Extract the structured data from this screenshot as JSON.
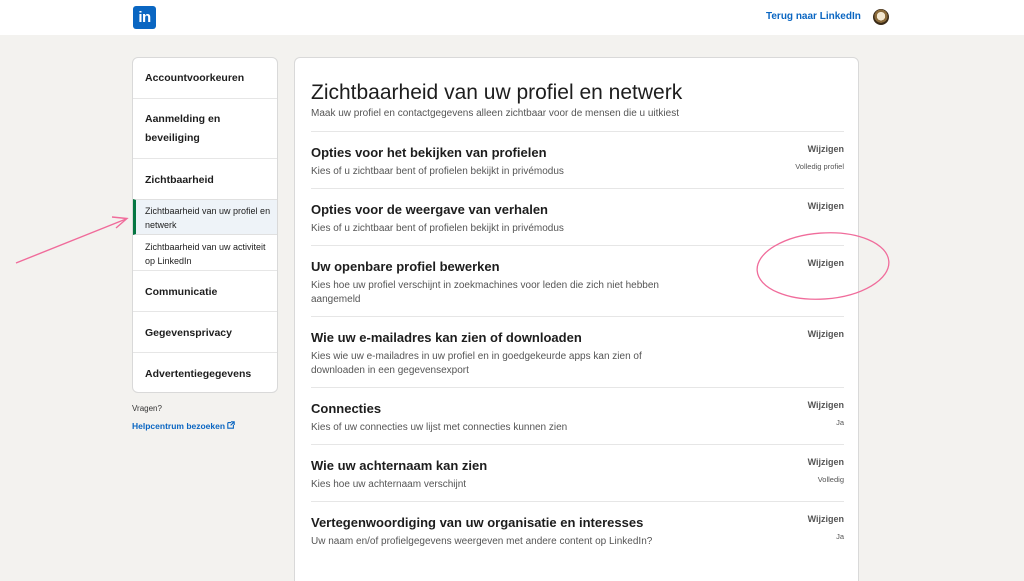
{
  "topbar": {
    "logo_text": "in",
    "back_link": "Terug naar LinkedIn"
  },
  "sidebar": {
    "items": [
      {
        "label": "Accountvoorkeuren"
      },
      {
        "label": "Aanmelding en beveiliging"
      },
      {
        "label": "Zichtbaarheid"
      },
      {
        "label": "Zichtbaarheid van uw profiel en netwerk"
      },
      {
        "label": "Zichtbaarheid van uw activiteit op LinkedIn"
      },
      {
        "label": "Communicatie"
      },
      {
        "label": "Gegevensprivacy"
      },
      {
        "label": "Advertentiegegevens"
      }
    ],
    "questions": "Vragen?",
    "help_link": "Helpcentrum bezoeken"
  },
  "main": {
    "title": "Zichtbaarheid van uw profiel en netwerk",
    "subtitle": "Maak uw profiel en contactgegevens alleen zichtbaar voor de mensen die u uitkiest",
    "rows": [
      {
        "title": "Opties voor het bekijken van profielen",
        "desc": "Kies of u zichtbaar bent of profielen bekijkt in privémodus",
        "action": "Wijzigen",
        "value": "Volledig profiel"
      },
      {
        "title": "Opties voor de weergave van verhalen",
        "desc": "Kies of u zichtbaar bent of profielen bekijkt in privémodus",
        "action": "Wijzigen",
        "value": ""
      },
      {
        "title": "Uw openbare profiel bewerken",
        "desc": "Kies hoe uw profiel verschijnt in zoekmachines voor leden die zich niet hebben aangemeld",
        "action": "Wijzigen",
        "value": ""
      },
      {
        "title": "Wie uw e-mailadres kan zien of downloaden",
        "desc": "Kies wie uw e-mailadres in uw profiel en in goedgekeurde apps kan zien of downloaden in een gegevensexport",
        "action": "Wijzigen",
        "value": ""
      },
      {
        "title": "Connecties",
        "desc": "Kies of uw connecties uw lijst met connecties kunnen zien",
        "action": "Wijzigen",
        "value": "Ja"
      },
      {
        "title": "Wie uw achternaam kan zien",
        "desc": "Kies hoe uw achternaam verschijnt",
        "action": "Wijzigen",
        "value": "Volledig"
      },
      {
        "title": "Vertegenwoordiging van uw organisatie en interesses",
        "desc": "Uw naam en/of profielgegevens weergeven met andere content op LinkedIn?",
        "action": "Wijzigen",
        "value": "Ja"
      }
    ]
  },
  "colors": {
    "brand": "#0a66c2",
    "active_indicator": "#057642",
    "annotation": "#f06c9b"
  },
  "icons": {
    "external_link": "external-link-icon"
  }
}
